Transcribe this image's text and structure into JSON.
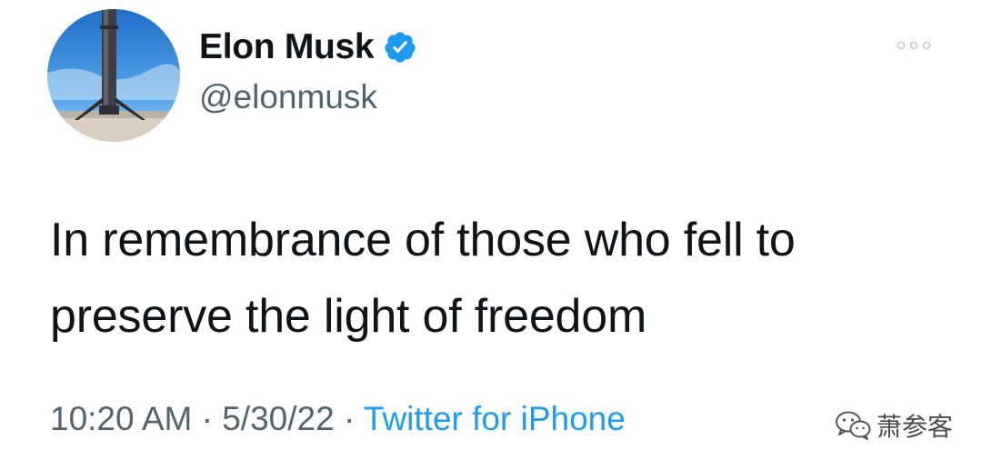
{
  "tweet": {
    "display_name": "Elon Musk",
    "handle": "@elonmusk",
    "text_line1": "In remembrance of those who fell to",
    "text_line2": "preserve the light of freedom",
    "time": "10:20 AM",
    "separator": " · ",
    "date": "5/30/22",
    "source": "Twitter for iPhone"
  },
  "icons": {
    "verified": "verified-badge-icon",
    "more": "more-options-icon",
    "avatar": "rocket-booster-avatar"
  },
  "watermark": {
    "text": "萧参客",
    "logo": "wechat-logo"
  },
  "colors": {
    "name": "#0f1419",
    "secondary": "#536471",
    "link": "#1d9bf0",
    "verified": "#1d9bf0"
  }
}
